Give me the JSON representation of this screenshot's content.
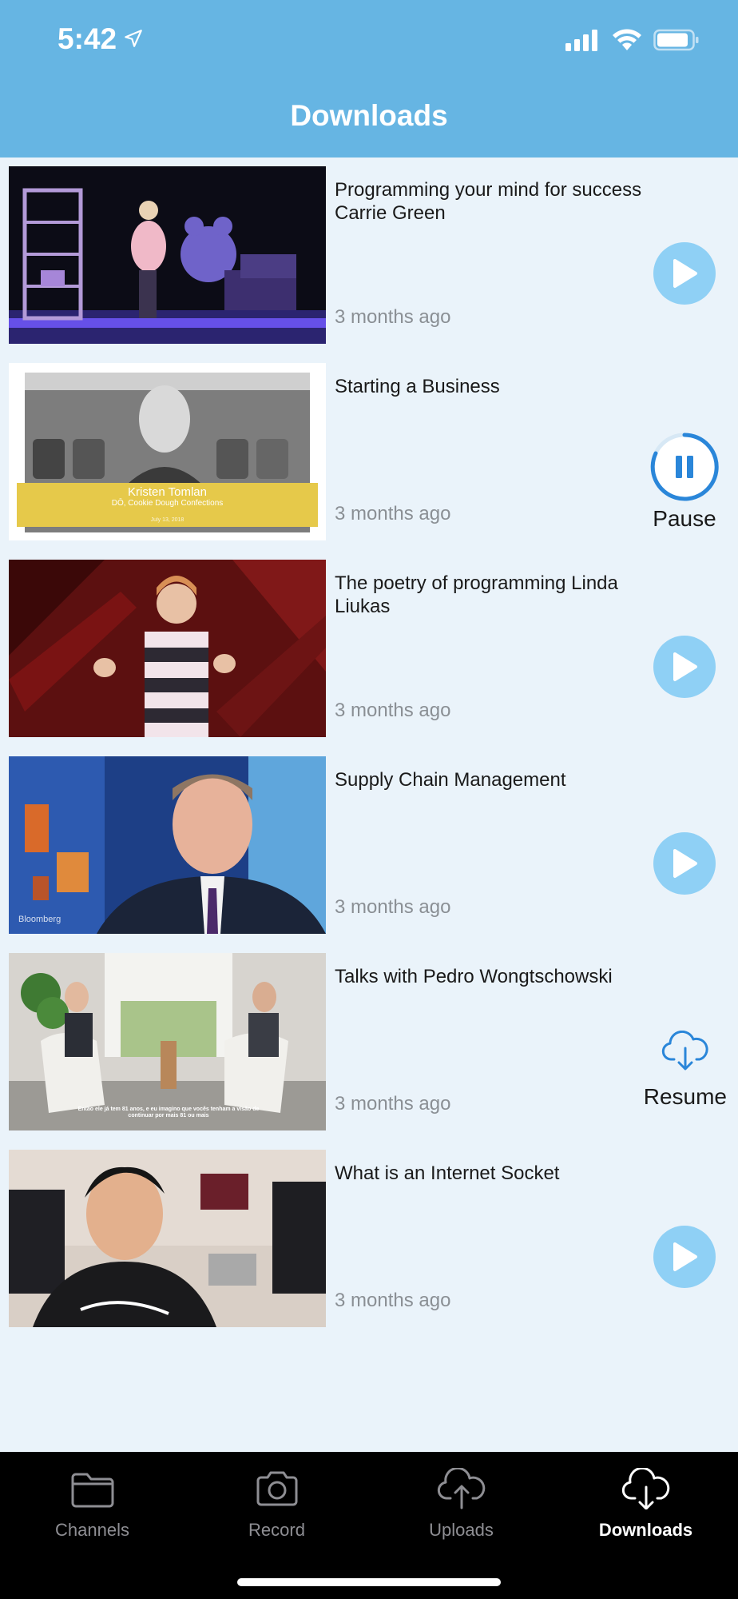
{
  "status": {
    "time": "5:42"
  },
  "header": {
    "title": "Downloads"
  },
  "items": [
    {
      "title": "Programming your mind for success Carrie Green",
      "time": "3 months ago",
      "action": "play"
    },
    {
      "title": "Starting a Business",
      "time": "3 months ago",
      "action": "pause",
      "action_label": "Pause",
      "thumb_caption_name": "Kristen Tomlan",
      "thumb_caption_role": "DŌ, Cookie Dough Confections",
      "thumb_caption_date": "July 13, 2018"
    },
    {
      "title": "The poetry of programming Linda Liukas",
      "time": "3 months ago",
      "action": "play"
    },
    {
      "title": "Supply Chain Management",
      "time": "3 months ago",
      "action": "play",
      "thumb_watermark": "Bloomberg"
    },
    {
      "title": "Talks with Pedro Wongtschowski",
      "time": "3 months ago",
      "action": "resume",
      "action_label": "Resume",
      "thumb_subtitle": "Então ele já tem 81 anos, e eu imagino que vocês tenham a visão de continuar por mais 81 ou mais"
    },
    {
      "title": "What is an Internet Socket",
      "time": "3 months ago",
      "action": "play"
    }
  ],
  "tabs": [
    {
      "label": "Channels",
      "icon": "folder-icon",
      "active": false
    },
    {
      "label": "Record",
      "icon": "camera-icon",
      "active": false
    },
    {
      "label": "Uploads",
      "icon": "cloud-upload-icon",
      "active": false
    },
    {
      "label": "Downloads",
      "icon": "cloud-download-icon",
      "active": true
    }
  ],
  "colors": {
    "header": "#66b5e3",
    "accent": "#2a86d9",
    "play": "#8fd0f5",
    "background": "#eaf3fa"
  }
}
